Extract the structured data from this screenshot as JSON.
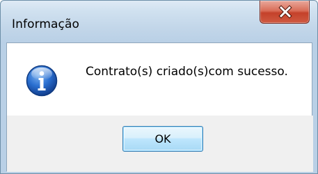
{
  "dialog": {
    "title": "Informação",
    "message": "Contrato(s) criado(s)com sucesso.",
    "ok_label": "OK",
    "close_glyph": "X",
    "icon": "info-icon"
  },
  "colors": {
    "frame": "#c2d6e9",
    "close_button": "#c4412a",
    "ok_button_border": "#3c7fb1",
    "info_icon": "#1f5fb8"
  }
}
